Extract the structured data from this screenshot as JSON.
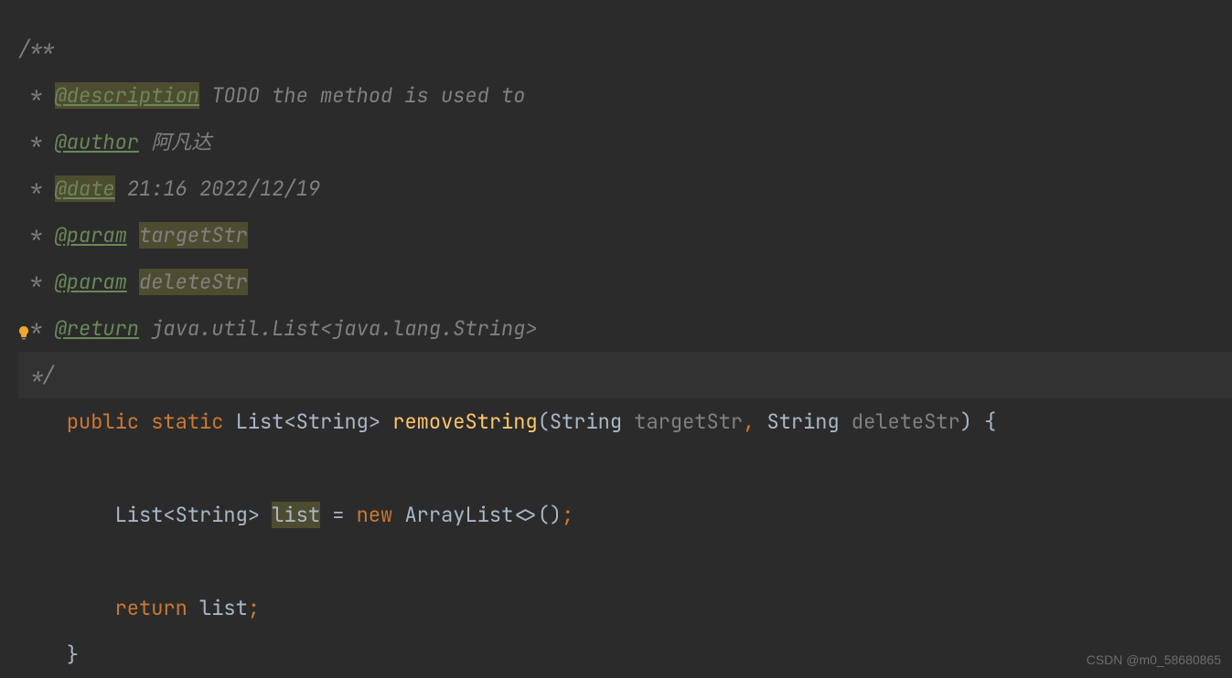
{
  "doc": {
    "open": "/**",
    "star": " * ",
    "tags": {
      "description": "@description",
      "author": "@author",
      "date": "@date",
      "param": "@param",
      "return": "@return"
    },
    "desc_text": "TODO the method is used to",
    "author_text": "阿凡达",
    "date_text": "21:16 2022/12/19",
    "param1": "targetStr",
    "param2": "deleteStr",
    "return_text_1": "java.util.List",
    "return_text_lt": "<",
    "return_text_2": "java.lang.String",
    "return_text_gt": ">",
    "close": " */"
  },
  "code": {
    "kw_public": "public",
    "kw_static": "static",
    "type_list": "List",
    "type_string": "String",
    "gen_open": "<",
    "gen_close": ">",
    "method_name": "removeString",
    "paren_open": "(",
    "param1_name": "targetStr",
    "comma": ",",
    "param2_name": "deleteStr",
    "paren_close": ")",
    "brace_open": "{",
    "var_list": "list",
    "eq": " = ",
    "kw_new": "new",
    "type_arraylist": "ArrayList",
    "diamond": "<>",
    "call": "()",
    "semi": ";",
    "kw_return": "return",
    "ret_var": "list",
    "brace_close": "}"
  },
  "watermark": "CSDN @m0_58680865"
}
